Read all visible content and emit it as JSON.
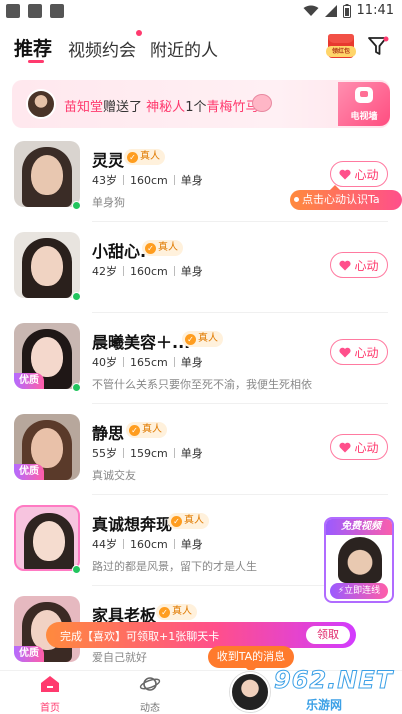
{
  "status_bar": {
    "time": "11:41"
  },
  "tabs": [
    {
      "label": "推荐",
      "active": true
    },
    {
      "label": "视频约会",
      "active": false,
      "dot": true
    },
    {
      "label": "附近的人",
      "active": false
    }
  ],
  "header": {
    "redpack_label": "领红包",
    "filter_icon": "filter-icon"
  },
  "banner": {
    "user": "苗知堂",
    "verb": "赠送了",
    "target": "神秘人",
    "amount": "1个",
    "gift": "青梅竹马",
    "tvwall_label": "电视墙"
  },
  "cards": [
    {
      "name": "灵灵",
      "verified": "真人",
      "age": "43岁",
      "height": "160cm",
      "status": "单身",
      "signature": "单身狗",
      "quality": "",
      "online": true,
      "action": "心动"
    },
    {
      "name": "小甜心.",
      "verified": "真人",
      "age": "42岁",
      "height": "160cm",
      "status": "单身",
      "signature": "",
      "quality": "",
      "online": true,
      "action": "心动"
    },
    {
      "name": "晨曦美容＋...",
      "verified": "真人",
      "age": "40岁",
      "height": "165cm",
      "status": "单身",
      "signature": "不管什么关系只要你至死不渝，我便生死相依",
      "quality": "优质",
      "online": true,
      "action": "心动"
    },
    {
      "name": "静思",
      "verified": "真人",
      "age": "55岁",
      "height": "159cm",
      "status": "单身",
      "signature": "真诚交友",
      "quality": "优质",
      "online": false,
      "action": "心动"
    },
    {
      "name": "真诚想奔现",
      "verified": "真人",
      "age": "44岁",
      "height": "160cm",
      "status": "单身",
      "signature": "路过的都是风景，留下的才是人生",
      "quality": "",
      "online": true,
      "action": ""
    },
    {
      "name": "家具老板",
      "verified": "真人",
      "age": "",
      "height": "",
      "status": "",
      "signature": "爱自己就好",
      "quality": "优质",
      "online": false,
      "action": ""
    }
  ],
  "tooltip": "点击心动认识Ta",
  "free_video": {
    "title": "免费视频",
    "cta": "⚡立即连线"
  },
  "task_bar": {
    "text": "完成【喜欢】可领取+1张聊天卡",
    "claim": "领取"
  },
  "message_bubble": "收到TA的消息",
  "bottom_nav": [
    {
      "label": "首页",
      "active": true
    },
    {
      "label": "动态",
      "active": false
    }
  ],
  "watermark": {
    "big": "962.NET",
    "small": "乐游网"
  },
  "colors": {
    "accent": "#ff3a6e",
    "verified_bg": "#fff1dc",
    "online": "#22c55e"
  }
}
